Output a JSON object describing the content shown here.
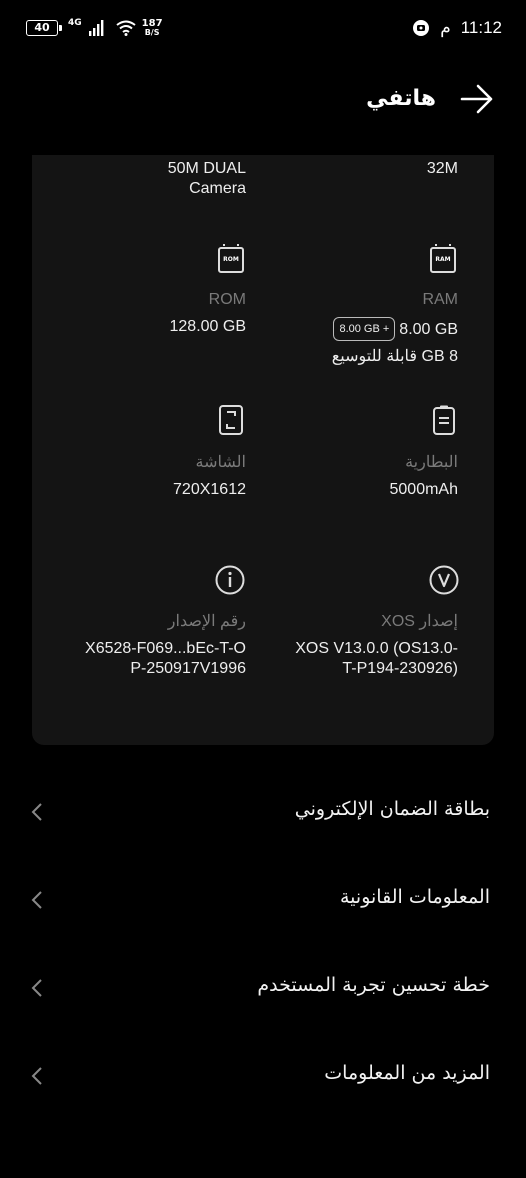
{
  "status_bar": {
    "battery": "40",
    "network": "4G",
    "speed_value": "187",
    "speed_unit": "B/S",
    "time": "11:12",
    "ampm": "م"
  },
  "header": {
    "title": "هاتفي"
  },
  "specs": {
    "camera_front_value": "32M",
    "camera_rear_value_line1": "50M DUAL",
    "camera_rear_value_line2": "Camera",
    "ram_icon_text": "RAM",
    "ram_label": "RAM",
    "ram_badge": "8.00 GB +",
    "ram_value": "8.00 GB",
    "ram_expand": "8 GB قابلة للتوسيع",
    "rom_icon_text": "ROM",
    "rom_label": "ROM",
    "rom_value": "128.00 GB",
    "battery_label": "البطارية",
    "battery_value": "5000mAh",
    "screen_label": "الشاشة",
    "screen_value": "720X1612",
    "xos_label": "إصدار XOS",
    "xos_value_line1": "XOS V13.0.0 (OS13.0-",
    "xos_value_line2": "T-P194-230926)",
    "build_label": "رقم الإصدار",
    "build_value_line1": "X6528-F069...bEc-T-O",
    "build_value_line2": "P-250917V1996"
  },
  "menu": [
    {
      "label": "بطاقة الضمان الإلكتروني"
    },
    {
      "label": "المعلومات القانونية"
    },
    {
      "label": "خطة تحسين تجربة المستخدم"
    },
    {
      "label": "المزيد من المعلومات"
    }
  ],
  "colors": {
    "background": "#000000",
    "card": "#141414",
    "label": "#7a7a7a"
  }
}
